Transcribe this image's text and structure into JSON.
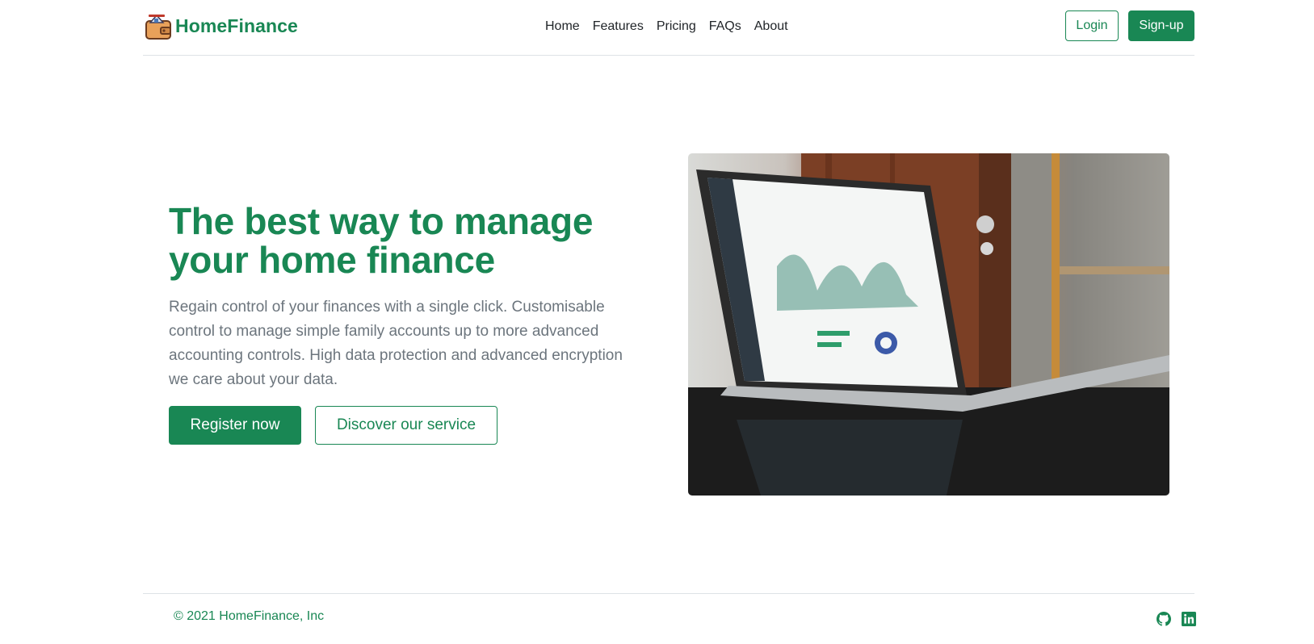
{
  "brand": {
    "name": "HomeFinance",
    "logo_icon": "wallet-house-icon"
  },
  "nav": {
    "links": [
      {
        "label": "Home"
      },
      {
        "label": "Features"
      },
      {
        "label": "Pricing"
      },
      {
        "label": "FAQs"
      },
      {
        "label": "About"
      }
    ],
    "login_label": "Login",
    "signup_label": "Sign-up"
  },
  "hero": {
    "title": "The best way to manage your home finance",
    "lead": "Regain control of your finances with a single click. Customisable control to manage simple family accounts up to more advanced accounting controls. High data protection and advanced encryption we care about your data.",
    "primary_cta": "Register now",
    "secondary_cta": "Discover our service",
    "image_alt": "laptop-dashboard-photo"
  },
  "footer": {
    "copyright": "© 2021 HomeFinance, Inc",
    "social": [
      {
        "icon": "github-icon"
      },
      {
        "icon": "linkedin-icon"
      }
    ]
  },
  "colors": {
    "brand_green": "#198754",
    "text_dark": "#212529",
    "text_muted": "#6c757d",
    "divider": "#dee2e6"
  }
}
